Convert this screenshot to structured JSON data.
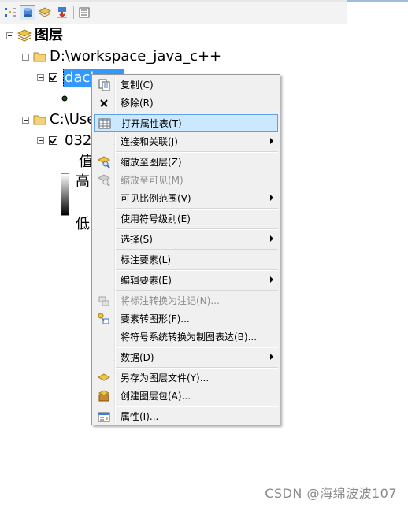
{
  "tree": {
    "root_label": "图层",
    "group1_label": "D:\\workspace_java_c++",
    "layer1_label": "dach",
    "group2_label": "C:\\Use",
    "layer2_label": "032",
    "legend_value_label": "值",
    "legend_high": "高",
    "legend_low": "低"
  },
  "menu": {
    "copy": "复制(C)",
    "remove": "移除(R)",
    "open_table": "打开属性表(T)",
    "joins": "连接和关联(J)",
    "zoom_layer": "缩放至图层(Z)",
    "zoom_visible": "缩放至可见(M)",
    "scale_range": "可见比例范围(V)",
    "symbol_levels": "使用符号级别(E)",
    "selection": "选择(S)",
    "label_features": "标注要素(L)",
    "edit_features": "编辑要素(E)",
    "convert_labels": "将标注转换为注记(N)...",
    "convert_graphics": "要素转图形(F)...",
    "convert_symbology": "将符号系统转换为制图表达(B)...",
    "data": "数据(D)",
    "save_layer": "另存为图层文件(Y)...",
    "create_package": "创建图层包(A)...",
    "properties": "属性(I)..."
  },
  "watermark": "CSDN @海绵波波107"
}
